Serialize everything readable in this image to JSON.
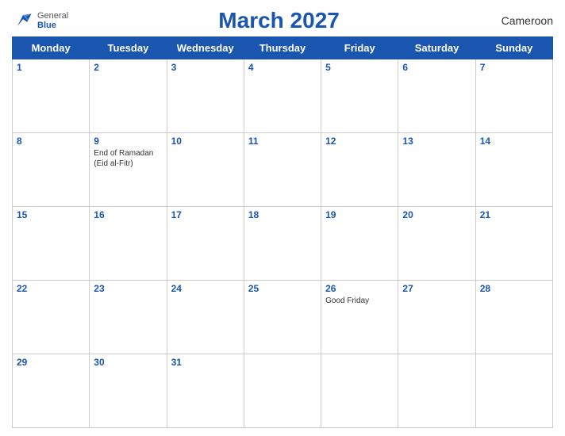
{
  "header": {
    "logo_general": "General",
    "logo_blue": "Blue",
    "title": "March 2027",
    "country": "Cameroon"
  },
  "weekdays": [
    "Monday",
    "Tuesday",
    "Wednesday",
    "Thursday",
    "Friday",
    "Saturday",
    "Sunday"
  ],
  "weeks": [
    [
      {
        "day": "1",
        "events": []
      },
      {
        "day": "2",
        "events": []
      },
      {
        "day": "3",
        "events": []
      },
      {
        "day": "4",
        "events": []
      },
      {
        "day": "5",
        "events": []
      },
      {
        "day": "6",
        "events": []
      },
      {
        "day": "7",
        "events": []
      }
    ],
    [
      {
        "day": "8",
        "events": []
      },
      {
        "day": "9",
        "events": [
          "End of Ramadan (Eid al-Fitr)"
        ]
      },
      {
        "day": "10",
        "events": []
      },
      {
        "day": "11",
        "events": []
      },
      {
        "day": "12",
        "events": []
      },
      {
        "day": "13",
        "events": []
      },
      {
        "day": "14",
        "events": []
      }
    ],
    [
      {
        "day": "15",
        "events": []
      },
      {
        "day": "16",
        "events": []
      },
      {
        "day": "17",
        "events": []
      },
      {
        "day": "18",
        "events": []
      },
      {
        "day": "19",
        "events": []
      },
      {
        "day": "20",
        "events": []
      },
      {
        "day": "21",
        "events": []
      }
    ],
    [
      {
        "day": "22",
        "events": []
      },
      {
        "day": "23",
        "events": []
      },
      {
        "day": "24",
        "events": []
      },
      {
        "day": "25",
        "events": []
      },
      {
        "day": "26",
        "events": [
          "Good Friday"
        ]
      },
      {
        "day": "27",
        "events": []
      },
      {
        "day": "28",
        "events": []
      }
    ],
    [
      {
        "day": "29",
        "events": []
      },
      {
        "day": "30",
        "events": []
      },
      {
        "day": "31",
        "events": []
      },
      {
        "day": "",
        "events": []
      },
      {
        "day": "",
        "events": []
      },
      {
        "day": "",
        "events": []
      },
      {
        "day": "",
        "events": []
      }
    ]
  ]
}
